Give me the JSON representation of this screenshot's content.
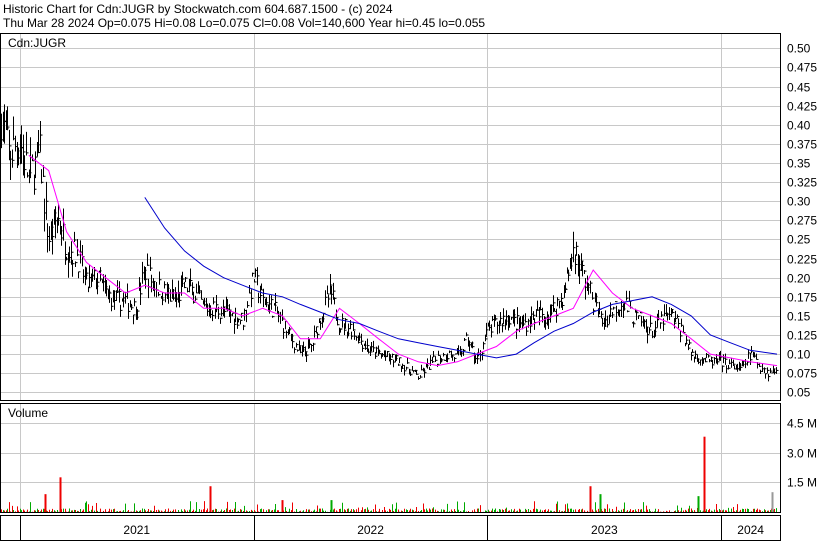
{
  "header": {
    "line1": "Historic Chart for Cdn:JUGR by Stockwatch.com 604.687.1500 - (c) 2024",
    "line2": "Thu Mar 28 2024   Op=0.075  Hi=0.08  Lo=0.075  Cl=0.08  Vol=140,600   Year hi=0.45  lo=0.055"
  },
  "colors": {
    "price_bars": "#000000",
    "ma_short": "#ff00ff",
    "ma_long": "#0000cc",
    "grid": "#c8c8c8",
    "volume_up": "#00aa00",
    "volume_down": "#ee0000",
    "volume_flat": "#999999"
  },
  "chart_data": [
    {
      "type": "line",
      "panel": "price",
      "title": "Cdn:JUGR",
      "y_tick_labels": [
        "0.05",
        "0.075",
        "0.10",
        "0.125",
        "0.15",
        "0.175",
        "0.20",
        "0.225",
        "0.25",
        "0.275",
        "0.30",
        "0.325",
        "0.35",
        "0.375",
        "0.40",
        "0.425",
        "0.45",
        "0.475",
        "0.50"
      ],
      "ylim": [
        0.04,
        0.52
      ],
      "x_tick_labels": [
        "2021",
        "2022",
        "2023",
        "2024"
      ],
      "x_range": [
        "2020-12-01",
        "2024-03-28"
      ],
      "grid": true,
      "series": [
        {
          "kind": "daily price bars (approx. closes)",
          "dates": [
            "2020-12-01",
            "2020-12-15",
            "2021-01-01",
            "2021-01-15",
            "2021-02-01",
            "2021-02-15",
            "2021-03-01",
            "2021-03-15",
            "2021-04-01",
            "2021-04-15",
            "2021-05-01",
            "2021-05-15",
            "2021-06-01",
            "2021-06-15",
            "2021-07-01",
            "2021-07-15",
            "2021-08-01",
            "2021-08-15",
            "2021-09-01",
            "2021-09-15",
            "2021-10-01",
            "2021-10-15",
            "2021-11-01",
            "2021-11-15",
            "2021-12-01",
            "2021-12-15",
            "2022-01-01",
            "2022-01-15",
            "2022-02-01",
            "2022-02-15",
            "2022-03-01",
            "2022-03-15",
            "2022-04-01",
            "2022-04-15",
            "2022-05-01",
            "2022-05-15",
            "2022-06-01",
            "2022-06-15",
            "2022-07-01",
            "2022-07-15",
            "2022-08-01",
            "2022-08-15",
            "2022-09-01",
            "2022-09-15",
            "2022-10-01",
            "2022-10-15",
            "2022-11-01",
            "2022-11-15",
            "2022-12-01",
            "2022-12-15",
            "2023-01-01",
            "2023-01-15",
            "2023-02-01",
            "2023-02-15",
            "2023-03-01",
            "2023-03-15",
            "2023-04-01",
            "2023-04-15",
            "2023-05-01",
            "2023-05-15",
            "2023-06-01",
            "2023-06-15",
            "2023-07-01",
            "2023-07-15",
            "2023-08-01",
            "2023-08-15",
            "2023-09-01",
            "2023-09-15",
            "2023-10-01",
            "2023-10-15",
            "2023-11-01",
            "2023-11-15",
            "2023-12-01",
            "2023-12-15",
            "2024-01-01",
            "2024-01-15",
            "2024-02-01",
            "2024-02-15",
            "2024-03-01",
            "2024-03-15",
            "2024-03-28"
          ],
          "values": [
            0.42,
            0.36,
            0.38,
            0.33,
            0.36,
            0.25,
            0.28,
            0.24,
            0.23,
            0.19,
            0.2,
            0.18,
            0.17,
            0.17,
            0.16,
            0.21,
            0.19,
            0.18,
            0.17,
            0.19,
            0.18,
            0.16,
            0.16,
            0.155,
            0.15,
            0.145,
            0.2,
            0.17,
            0.16,
            0.14,
            0.12,
            0.1,
            0.11,
            0.15,
            0.18,
            0.14,
            0.135,
            0.12,
            0.105,
            0.1,
            0.095,
            0.09,
            0.08,
            0.07,
            0.085,
            0.095,
            0.1,
            0.095,
            0.12,
            0.09,
            0.13,
            0.14,
            0.15,
            0.14,
            0.14,
            0.15,
            0.15,
            0.16,
            0.18,
            0.24,
            0.2,
            0.17,
            0.14,
            0.16,
            0.17,
            0.15,
            0.14,
            0.13,
            0.145,
            0.15,
            0.13,
            0.1,
            0.095,
            0.09,
            0.09,
            0.085,
            0.08,
            0.1,
            0.085,
            0.075,
            0.08
          ]
        },
        {
          "name": "",
          "kind": "short moving average",
          "dates": [
            "2021-01-15",
            "2021-02-15",
            "2021-03-15",
            "2021-04-15",
            "2021-05-15",
            "2021-06-15",
            "2021-07-15",
            "2021-08-15",
            "2021-09-15",
            "2021-10-15",
            "2021-11-15",
            "2021-12-15",
            "2022-01-15",
            "2022-02-15",
            "2022-03-15",
            "2022-04-15",
            "2022-05-15",
            "2022-06-15",
            "2022-07-15",
            "2022-08-15",
            "2022-09-15",
            "2022-10-15",
            "2022-11-15",
            "2022-12-15",
            "2023-01-15",
            "2023-02-15",
            "2023-03-15",
            "2023-04-15",
            "2023-05-15",
            "2023-06-15",
            "2023-07-15",
            "2023-08-15",
            "2023-09-15",
            "2023-10-15",
            "2023-11-15",
            "2023-12-15",
            "2024-01-15",
            "2024-02-15",
            "2024-03-28"
          ],
          "values": [
            0.36,
            0.34,
            0.26,
            0.22,
            0.2,
            0.18,
            0.19,
            0.18,
            0.18,
            0.16,
            0.16,
            0.15,
            0.16,
            0.15,
            0.12,
            0.12,
            0.16,
            0.14,
            0.12,
            0.1,
            0.09,
            0.085,
            0.09,
            0.1,
            0.11,
            0.13,
            0.14,
            0.15,
            0.16,
            0.21,
            0.18,
            0.16,
            0.15,
            0.14,
            0.12,
            0.1,
            0.095,
            0.09,
            0.085
          ]
        },
        {
          "name": "",
          "kind": "long moving average",
          "dates": [
            "2021-07-15",
            "2021-08-15",
            "2021-09-15",
            "2021-10-15",
            "2021-11-15",
            "2021-12-15",
            "2022-01-15",
            "2022-02-15",
            "2022-03-15",
            "2022-04-15",
            "2022-05-15",
            "2022-06-15",
            "2022-07-15",
            "2022-08-15",
            "2022-09-15",
            "2022-10-15",
            "2022-11-15",
            "2022-12-15",
            "2023-01-15",
            "2023-02-15",
            "2023-03-15",
            "2023-04-15",
            "2023-05-15",
            "2023-06-15",
            "2023-07-15",
            "2023-08-15",
            "2023-09-15",
            "2023-10-15",
            "2023-11-15",
            "2023-12-15",
            "2024-01-15",
            "2024-02-15",
            "2024-03-28"
          ],
          "values": [
            0.305,
            0.265,
            0.235,
            0.215,
            0.2,
            0.19,
            0.18,
            0.175,
            0.165,
            0.155,
            0.145,
            0.14,
            0.13,
            0.12,
            0.115,
            0.11,
            0.105,
            0.1,
            0.095,
            0.1,
            0.115,
            0.13,
            0.14,
            0.155,
            0.165,
            0.17,
            0.175,
            0.165,
            0.15,
            0.125,
            0.115,
            0.105,
            0.1
          ]
        }
      ]
    },
    {
      "type": "bar",
      "panel": "volume",
      "title": "Volume",
      "y_tick_labels": [
        "1.5 M",
        "3.0 M",
        "4.5 M"
      ],
      "ylim": [
        0,
        5.5
      ],
      "note": "values in millions of shares; spikes at notable dates",
      "spikes": [
        {
          "date": "2021-03-05",
          "value": 1.75,
          "dir": "down"
        },
        {
          "date": "2021-02-10",
          "value": 0.9,
          "dir": "down"
        },
        {
          "date": "2021-10-25",
          "value": 1.3,
          "dir": "down"
        },
        {
          "date": "2022-02-15",
          "value": 0.6,
          "dir": "down"
        },
        {
          "date": "2022-05-01",
          "value": 0.6,
          "dir": "up"
        },
        {
          "date": "2023-06-10",
          "value": 1.3,
          "dir": "down"
        },
        {
          "date": "2023-06-25",
          "value": 0.9,
          "dir": "up"
        },
        {
          "date": "2023-12-05",
          "value": 3.8,
          "dir": "down"
        },
        {
          "date": "2023-11-25",
          "value": 0.8,
          "dir": "up"
        },
        {
          "date": "2024-03-20",
          "value": 1.0,
          "dir": "flat"
        }
      ]
    }
  ]
}
